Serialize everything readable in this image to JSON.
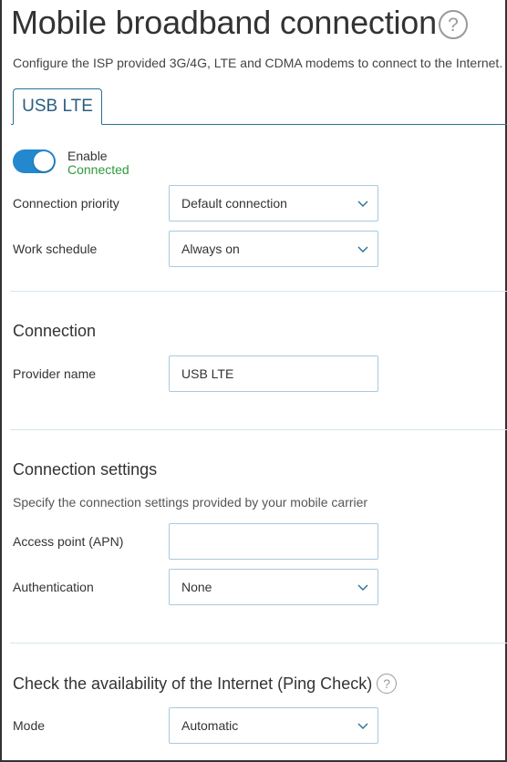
{
  "header": {
    "title": "Mobile broadband connection",
    "help_icon_glyph": "?",
    "subtitle": "Configure the ISP provided 3G/4G, LTE and CDMA modems to connect to the Internet."
  },
  "tabs": [
    {
      "label": "USB LTE",
      "active": true
    }
  ],
  "general": {
    "enable_label": "Enable",
    "enabled": true,
    "status": "Connected",
    "priority_label": "Connection priority",
    "priority_value": "Default connection",
    "schedule_label": "Work schedule",
    "schedule_value": "Always on"
  },
  "connection": {
    "title": "Connection",
    "provider_label": "Provider name",
    "provider_value": "USB LTE"
  },
  "connection_settings": {
    "title": "Connection settings",
    "description": "Specify the connection settings provided by your mobile carrier",
    "apn_label": "Access point (APN)",
    "apn_value": "",
    "auth_label": "Authentication",
    "auth_value": "None"
  },
  "ping_check": {
    "title": "Check the availability of the Internet (Ping Check)",
    "help_icon_glyph": "?",
    "mode_label": "Mode",
    "mode_value": "Automatic"
  },
  "colors": {
    "accent": "#2488cf",
    "tab_border": "#2a6f97",
    "status_ok": "#2e9a3c",
    "field_border": "#a9c9df"
  },
  "icons": {
    "help": "question-circle-icon",
    "dropdown": "chevron-down-icon"
  }
}
